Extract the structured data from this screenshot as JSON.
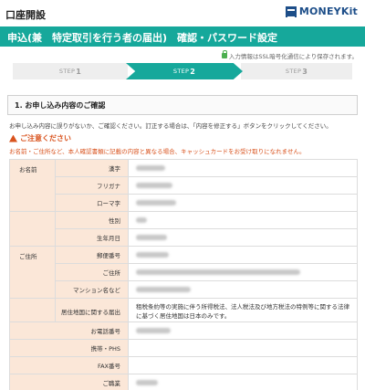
{
  "header": {
    "page_title": "口座開設",
    "logo_text": "MONEYKit"
  },
  "titlebar": {
    "title": "申込(兼　特定取引を行う者の届出)　確認・パスワード設定"
  },
  "ssl_note": "入力情報はSSL暗号化通信により保存されます。",
  "steps": [
    {
      "label": "STEP",
      "num": "1",
      "active": false
    },
    {
      "label": "STEP",
      "num": "2",
      "active": true
    },
    {
      "label": "STEP",
      "num": "3",
      "active": false
    }
  ],
  "section": {
    "title": "1. お申し込み内容のご確認"
  },
  "intro_text": "お申し込み内容に誤りがないか、ご確認ください。訂正する場合は、「内容を修正する」ボタンをクリックしてください。",
  "caution": {
    "title": "ご注意ください",
    "text": "お名前・ご住所など、本人確認書類に記載の内容と異なる場合、キャッシュカードをお受け取りになれません。"
  },
  "table1": {
    "name_category": "お名前",
    "address_category": "ご住所",
    "rows": {
      "kanji": "漢字",
      "furigana": "フリガナ",
      "romaji": "ローマ字",
      "gender": "性別",
      "birthdate": "生年月日",
      "postal": "郵便番号",
      "address": "ご住所",
      "building": "マンション名など",
      "residence_label": "居住地国に関する届出",
      "residence_note": "租税条約等の実施に伴う所得税法、法人税法及び地方税法の特例等に関する法律に基づく居住地国は日本のみです。"
    }
  },
  "table2": {
    "rows": {
      "phone": "お電話番号",
      "mobile": "携帯・PHS",
      "fax": "FAX番号",
      "occupation": "ご職業"
    }
  },
  "colors": {
    "accent": "#16a89b",
    "warning": "#d9531e",
    "label_bg": "#fbe7d8",
    "brand": "#1d4e89"
  }
}
